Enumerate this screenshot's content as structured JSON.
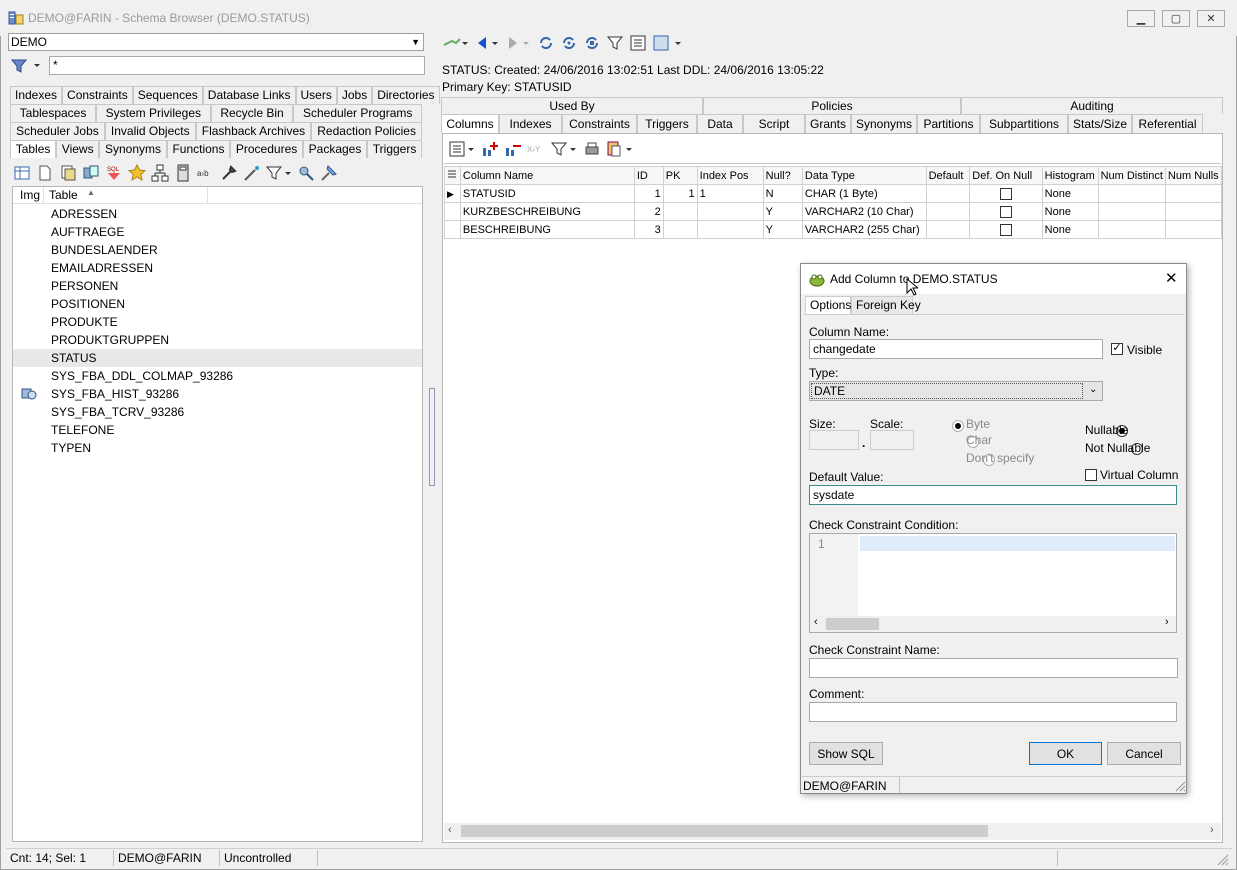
{
  "window": {
    "title": "DEMO@FARIN - Schema Browser (DEMO.STATUS)",
    "minimize": "▁",
    "maximize": "▢",
    "close": "✕"
  },
  "left": {
    "schema": "DEMO",
    "filter": "*",
    "tab_rows": [
      [
        "Indexes",
        "Constraints",
        "Sequences",
        "Database Links",
        "Users",
        "Jobs",
        "Directories"
      ],
      [
        "Tablespaces",
        "System Privileges",
        "Recycle Bin",
        "Scheduler Programs"
      ],
      [
        "Scheduler Jobs",
        "Invalid Objects",
        "Flashback Archives",
        "Redaction Policies"
      ],
      [
        "Tables",
        "Views",
        "Synonyms",
        "Functions",
        "Procedures",
        "Packages",
        "Triggers"
      ]
    ],
    "list_header": {
      "img": "Img",
      "table": "Table"
    },
    "tables": [
      "ADRESSEN",
      "AUFTRAEGE",
      "BUNDESLAENDER",
      "EMAILADRESSEN",
      "PERSONEN",
      "POSITIONEN",
      "PRODUKTE",
      "PRODUKTGRUPPEN",
      "STATUS",
      "SYS_FBA_DDL_COLMAP_93286",
      "SYS_FBA_HIST_93286",
      "SYS_FBA_TCRV_93286",
      "TELEFONE",
      "TYPEN"
    ]
  },
  "right": {
    "info_line": "STATUS:   Created: 24/06/2016 13:02:51   Last DDL: 24/06/2016 13:05:22",
    "pk_line": "Primary Key:  STATUSID",
    "upper_tabs": [
      "Used By",
      "Policies",
      "Auditing"
    ],
    "tabs": [
      "Columns",
      "Indexes",
      "Constraints",
      "Triggers",
      "Data",
      "Script",
      "Grants",
      "Synonyms",
      "Partitions",
      "Subpartitions",
      "Stats/Size",
      "Referential"
    ],
    "grid_headers": [
      "Column Name",
      "ID",
      "PK",
      "Index Pos",
      "Null?",
      "Data Type",
      "Default",
      "Def. On Null",
      "Histogram",
      "Num Distinct",
      "Num Nulls"
    ],
    "rows": [
      {
        "name": "STATUSID",
        "id": "1",
        "pk": "1",
        "idx": "1",
        "null": "N",
        "type": "CHAR (1 Byte)",
        "default": "",
        "hist": "None"
      },
      {
        "name": "KURZBESCHREIBUNG",
        "id": "2",
        "pk": "",
        "idx": "",
        "null": "Y",
        "type": "VARCHAR2 (10 Char)",
        "default": "",
        "hist": "None"
      },
      {
        "name": "BESCHREIBUNG",
        "id": "3",
        "pk": "",
        "idx": "",
        "null": "Y",
        "type": "VARCHAR2 (255 Char)",
        "default": "",
        "hist": "None"
      }
    ]
  },
  "dialog": {
    "title": "Add Column to DEMO.STATUS",
    "tabs": [
      "Options",
      "Foreign Key"
    ],
    "column_name_label": "Column Name:",
    "column_name": "changedate",
    "visible_label": "Visible",
    "type_label": "Type:",
    "type_value": "DATE",
    "size_label": "Size:",
    "scale_label": "Scale:",
    "byte_label": "Byte",
    "char_label": "Char",
    "dont_specify_label": "Don't specify",
    "nullable_label": "Nullable",
    "not_nullable_label": "Not Nullable",
    "virtual_label": "Virtual Column",
    "default_label": "Default Value:",
    "default_value": "sysdate",
    "check_cond_label": "Check Constraint Condition:",
    "line_number": "1",
    "check_name_label": "Check Constraint Name:",
    "comment_label": "Comment:",
    "show_sql": "Show SQL",
    "ok": "OK",
    "cancel": "Cancel",
    "status": "DEMO@FARIN"
  },
  "statusbar": {
    "count": "Cnt: 14; Sel: 1",
    "connection": "DEMO@FARIN",
    "mode": "Uncontrolled"
  }
}
